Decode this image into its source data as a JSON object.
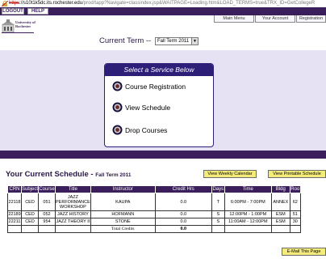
{
  "browser": {
    "url_protocol": "https",
    "url_host": "://s10t1k5dc.its.rochester.edu",
    "url_path": "/prod/tapp?Navigate=classindex.jsp&WAITPAGE=Loading.htm&LOAD_TERMS=true&TRX_ID=GetCollegeR"
  },
  "top_nav": {
    "logout": "LOGOUT",
    "help": "HELP",
    "main_menu": "Main Menu",
    "your_account": "Your Account",
    "registration": "Registration"
  },
  "logo": {
    "text": "University of Rochester"
  },
  "term": {
    "label": "Current Term --",
    "selected": "Fall Term 2011"
  },
  "services": {
    "title": "Select a Service Below",
    "items": [
      {
        "label": "Course Registration"
      },
      {
        "label": "View Schedule"
      },
      {
        "label": "Drop Courses"
      }
    ]
  },
  "schedule": {
    "title": "Your Current Schedule -",
    "term": "Fall Term 2011",
    "weekly_btn": "View Weekly Calendar",
    "printable_btn": "View Printable Schedule",
    "email_btn": "E-Mail This Page",
    "columns": [
      "CRN",
      "Subject",
      "Course",
      "Title",
      "Instructor",
      "Credit Hrs",
      "Days",
      "Time",
      "Bldg",
      "Roo"
    ],
    "rows": [
      [
        "22118",
        "CED",
        "051",
        "JAZZ PERFORMANCE WORKSHOP",
        "KAUPA",
        "0.0",
        "T",
        "6:00PM - 7:00PM",
        "ANNEX",
        "62"
      ],
      [
        "22189",
        "CED",
        "052",
        "JAZZ HISTORY",
        "HOFMANN",
        "0.0",
        "S",
        "12:00PM - 1:00PM",
        "ESM",
        "51"
      ],
      [
        "22211",
        "CED",
        "954",
        "JAZZ THEORY II",
        "STONE",
        "0.0",
        "S",
        "11:00AM - 12:00PM",
        "ESM",
        "30"
      ]
    ],
    "total_label": "Total Credits",
    "total_value": "0.0"
  },
  "colors": {
    "purple_dark": "#3a1f5c",
    "service_blue": "#2d1f78",
    "lavender": "#e6e2f3",
    "button_yellow": "#f3ec7a"
  },
  "icons": {
    "lock": "lock-icon",
    "radio": "radio-bullet-icon",
    "dropdown": "chevron-down-icon"
  }
}
